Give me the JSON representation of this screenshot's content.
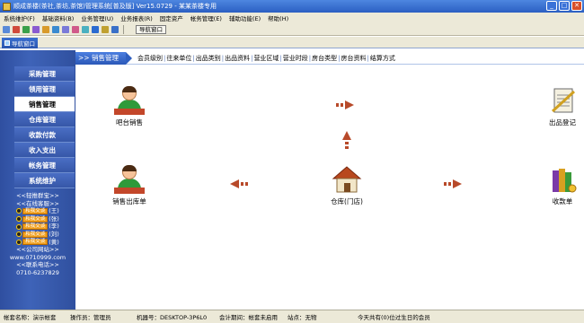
{
  "window": {
    "title": "顺成茶楼(茶社,茶坊,茶馆)管理系统[普及版] Ver15.0729 - 某某茶楼专用",
    "minimize": "_",
    "maximize": "□",
    "close": "✕"
  },
  "menubar": [
    "系统维护(F)",
    "基础资料(B)",
    "业务管理(U)",
    "业务报表(R)",
    "固定资产",
    "帐务管理(E)",
    "辅助功能(E)",
    "帮助(H)"
  ],
  "toolbar": {
    "icons": [
      "#5a8ad8",
      "#d04a3a",
      "#3aa04a",
      "#8a5ad0",
      "#d89a2a",
      "#3a8ad0",
      "#7a7ad8",
      "#d05a8a",
      "#4ab0c0",
      "#2a6ad0",
      "#c0a030",
      "#3a70c8"
    ],
    "button_label": "导航窗口"
  },
  "nav_tab": {
    "label": "导航窗口"
  },
  "sidebar": {
    "items": [
      {
        "label": "采购管理"
      },
      {
        "label": "领用管理"
      },
      {
        "label": "销售管理",
        "active": true
      },
      {
        "label": "仓库管理"
      },
      {
        "label": "收款付款"
      },
      {
        "label": "收入支出"
      },
      {
        "label": "帐务管理"
      },
      {
        "label": "系统维护"
      }
    ],
    "promo_heading": "<<轻推群宝>>",
    "support_heading": "<<在线客服>>",
    "support": [
      {
        "badge": "和我交谈",
        "name": "(王)"
      },
      {
        "badge": "和我交谈",
        "name": "(张)"
      },
      {
        "badge": "和我交谈",
        "name": "(李)"
      },
      {
        "badge": "和我交谈",
        "name": "(刘)"
      },
      {
        "badge": "和我交谈",
        "name": "(黄)"
      }
    ],
    "site_heading": "<<公司网站>>",
    "site_url": "www.0710999.com",
    "phone_heading": "<<联系电话>>",
    "phone": "0710-6237829"
  },
  "subnav": {
    "section": ">> 销售管理",
    "links": [
      "会员级别",
      "往来单位",
      "出品类别",
      "出品资料",
      "营业区域",
      "营业时段",
      "房台类型",
      "房台资料",
      "结算方式"
    ]
  },
  "flow": {
    "bar_sales": "吧台销售",
    "out_register": "出品登记",
    "sales_out": "销售出库单",
    "warehouse": "仓库(门店)",
    "receipt": "收款单"
  },
  "colors": {
    "accent": "#2b5fc2",
    "arrow": "#b84a2a",
    "sidebar": "#3e63b8"
  },
  "status": {
    "account_set": "帐套名称：演示帐套",
    "operator": "操作员：管理员",
    "machine": "机器号：DESKTOP-3P6L0",
    "accounting": "会计期间：帐套未启用",
    "station": "站点：无物",
    "birthdays": "今天共有(0)位过生日的会员"
  }
}
